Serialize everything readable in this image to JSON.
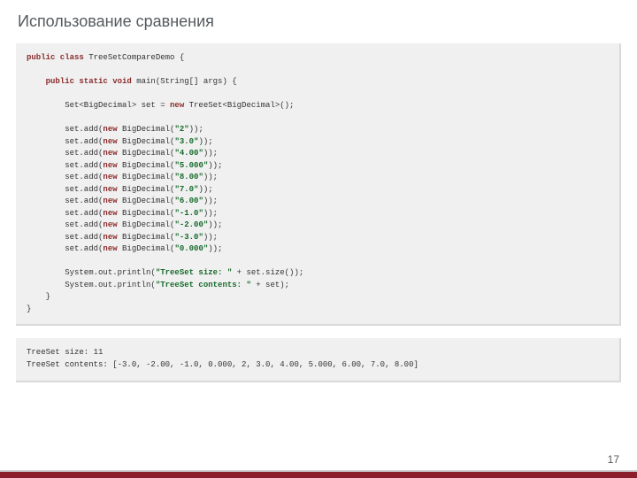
{
  "title": "Использование сравнения",
  "pageNumber": "17",
  "code": {
    "l1a": "public class",
    "l1b": " TreeSetCompareDemo {",
    "l2a": "    public static void",
    "l2b": " main(String[] args) {",
    "l3a": "        Set<BigDecimal> set = ",
    "l3b": "new",
    "l3c": " TreeSet<BigDecimal>();",
    "l4a": "        set.add(",
    "l4b": "new",
    "l4c": " BigDecimal(",
    "l4d": "\"2\"",
    "l4e": "));",
    "l5a": "        set.add(",
    "l5b": "new",
    "l5c": " BigDecimal(",
    "l5d": "\"3.0\"",
    "l5e": "));",
    "l6a": "        set.add(",
    "l6b": "new",
    "l6c": " BigDecimal(",
    "l6d": "\"4.00\"",
    "l6e": "));",
    "l7a": "        set.add(",
    "l7b": "new",
    "l7c": " BigDecimal(",
    "l7d": "\"5.000\"",
    "l7e": "));",
    "l8a": "        set.add(",
    "l8b": "new",
    "l8c": " BigDecimal(",
    "l8d": "\"8.00\"",
    "l8e": "));",
    "l9a": "        set.add(",
    "l9b": "new",
    "l9c": " BigDecimal(",
    "l9d": "\"7.0\"",
    "l9e": "));",
    "l10a": "        set.add(",
    "l10b": "new",
    "l10c": " BigDecimal(",
    "l10d": "\"6.00\"",
    "l10e": "));",
    "l11a": "        set.add(",
    "l11b": "new",
    "l11c": " BigDecimal(",
    "l11d": "\"-1.0\"",
    "l11e": "));",
    "l12a": "        set.add(",
    "l12b": "new",
    "l12c": " BigDecimal(",
    "l12d": "\"-2.00\"",
    "l12e": "));",
    "l13a": "        set.add(",
    "l13b": "new",
    "l13c": " BigDecimal(",
    "l13d": "\"-3.0\"",
    "l13e": "));",
    "l14a": "        set.add(",
    "l14b": "new",
    "l14c": " BigDecimal(",
    "l14d": "\"0.000\"",
    "l14e": "));",
    "l15a": "        System.out.println(",
    "l15b": "\"TreeSet size: \"",
    "l15c": " + set.size());",
    "l16a": "        System.out.println(",
    "l16b": "\"TreeSet contents: \"",
    "l16c": " + set);",
    "l17": "    }",
    "l18": "}"
  },
  "output": {
    "line1": "TreeSet size: 11",
    "line2": "TreeSet contents: [-3.0, -2.00, -1.0, 0.000, 2, 3.0, 4.00, 5.000, 6.00, 7.0, 8.00]"
  }
}
